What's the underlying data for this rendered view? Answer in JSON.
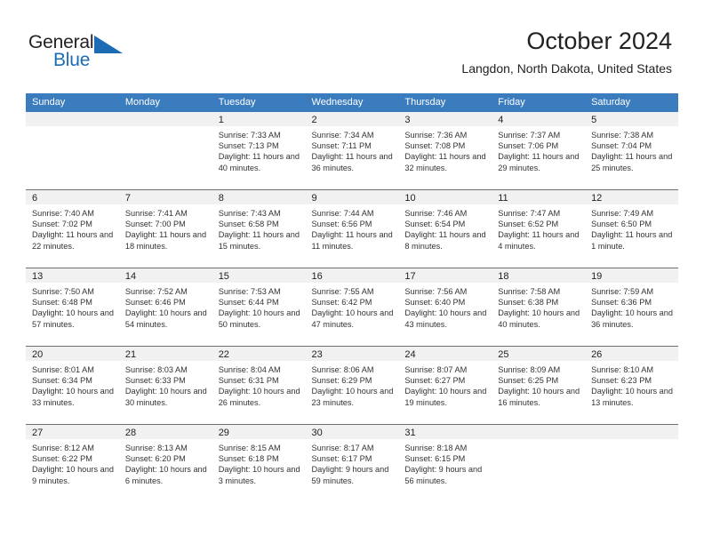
{
  "brand": {
    "name_part1": "General",
    "name_part2": "Blue",
    "triangle_icon": "triangle-icon",
    "accent_color": "#1b6cb5"
  },
  "header": {
    "title": "October 2024",
    "subtitle": "Langdon, North Dakota, United States"
  },
  "colors": {
    "header_row_bg": "#3a7cbe",
    "daynum_band_bg": "#f1f1f1",
    "grid_line": "#6f6f6f",
    "text": "#222222"
  },
  "weekday_headers": [
    "Sunday",
    "Monday",
    "Tuesday",
    "Wednesday",
    "Thursday",
    "Friday",
    "Saturday"
  ],
  "weeks": [
    [
      {
        "day": "",
        "sunrise": "",
        "sunset": "",
        "daylight": "",
        "empty": true
      },
      {
        "day": "",
        "sunrise": "",
        "sunset": "",
        "daylight": "",
        "empty": true
      },
      {
        "day": "1",
        "sunrise": "Sunrise: 7:33 AM",
        "sunset": "Sunset: 7:13 PM",
        "daylight": "Daylight: 11 hours and 40 minutes."
      },
      {
        "day": "2",
        "sunrise": "Sunrise: 7:34 AM",
        "sunset": "Sunset: 7:11 PM",
        "daylight": "Daylight: 11 hours and 36 minutes."
      },
      {
        "day": "3",
        "sunrise": "Sunrise: 7:36 AM",
        "sunset": "Sunset: 7:08 PM",
        "daylight": "Daylight: 11 hours and 32 minutes."
      },
      {
        "day": "4",
        "sunrise": "Sunrise: 7:37 AM",
        "sunset": "Sunset: 7:06 PM",
        "daylight": "Daylight: 11 hours and 29 minutes."
      },
      {
        "day": "5",
        "sunrise": "Sunrise: 7:38 AM",
        "sunset": "Sunset: 7:04 PM",
        "daylight": "Daylight: 11 hours and 25 minutes."
      }
    ],
    [
      {
        "day": "6",
        "sunrise": "Sunrise: 7:40 AM",
        "sunset": "Sunset: 7:02 PM",
        "daylight": "Daylight: 11 hours and 22 minutes."
      },
      {
        "day": "7",
        "sunrise": "Sunrise: 7:41 AM",
        "sunset": "Sunset: 7:00 PM",
        "daylight": "Daylight: 11 hours and 18 minutes."
      },
      {
        "day": "8",
        "sunrise": "Sunrise: 7:43 AM",
        "sunset": "Sunset: 6:58 PM",
        "daylight": "Daylight: 11 hours and 15 minutes."
      },
      {
        "day": "9",
        "sunrise": "Sunrise: 7:44 AM",
        "sunset": "Sunset: 6:56 PM",
        "daylight": "Daylight: 11 hours and 11 minutes."
      },
      {
        "day": "10",
        "sunrise": "Sunrise: 7:46 AM",
        "sunset": "Sunset: 6:54 PM",
        "daylight": "Daylight: 11 hours and 8 minutes."
      },
      {
        "day": "11",
        "sunrise": "Sunrise: 7:47 AM",
        "sunset": "Sunset: 6:52 PM",
        "daylight": "Daylight: 11 hours and 4 minutes."
      },
      {
        "day": "12",
        "sunrise": "Sunrise: 7:49 AM",
        "sunset": "Sunset: 6:50 PM",
        "daylight": "Daylight: 11 hours and 1 minute."
      }
    ],
    [
      {
        "day": "13",
        "sunrise": "Sunrise: 7:50 AM",
        "sunset": "Sunset: 6:48 PM",
        "daylight": "Daylight: 10 hours and 57 minutes."
      },
      {
        "day": "14",
        "sunrise": "Sunrise: 7:52 AM",
        "sunset": "Sunset: 6:46 PM",
        "daylight": "Daylight: 10 hours and 54 minutes."
      },
      {
        "day": "15",
        "sunrise": "Sunrise: 7:53 AM",
        "sunset": "Sunset: 6:44 PM",
        "daylight": "Daylight: 10 hours and 50 minutes."
      },
      {
        "day": "16",
        "sunrise": "Sunrise: 7:55 AM",
        "sunset": "Sunset: 6:42 PM",
        "daylight": "Daylight: 10 hours and 47 minutes."
      },
      {
        "day": "17",
        "sunrise": "Sunrise: 7:56 AM",
        "sunset": "Sunset: 6:40 PM",
        "daylight": "Daylight: 10 hours and 43 minutes."
      },
      {
        "day": "18",
        "sunrise": "Sunrise: 7:58 AM",
        "sunset": "Sunset: 6:38 PM",
        "daylight": "Daylight: 10 hours and 40 minutes."
      },
      {
        "day": "19",
        "sunrise": "Sunrise: 7:59 AM",
        "sunset": "Sunset: 6:36 PM",
        "daylight": "Daylight: 10 hours and 36 minutes."
      }
    ],
    [
      {
        "day": "20",
        "sunrise": "Sunrise: 8:01 AM",
        "sunset": "Sunset: 6:34 PM",
        "daylight": "Daylight: 10 hours and 33 minutes."
      },
      {
        "day": "21",
        "sunrise": "Sunrise: 8:03 AM",
        "sunset": "Sunset: 6:33 PM",
        "daylight": "Daylight: 10 hours and 30 minutes."
      },
      {
        "day": "22",
        "sunrise": "Sunrise: 8:04 AM",
        "sunset": "Sunset: 6:31 PM",
        "daylight": "Daylight: 10 hours and 26 minutes."
      },
      {
        "day": "23",
        "sunrise": "Sunrise: 8:06 AM",
        "sunset": "Sunset: 6:29 PM",
        "daylight": "Daylight: 10 hours and 23 minutes."
      },
      {
        "day": "24",
        "sunrise": "Sunrise: 8:07 AM",
        "sunset": "Sunset: 6:27 PM",
        "daylight": "Daylight: 10 hours and 19 minutes."
      },
      {
        "day": "25",
        "sunrise": "Sunrise: 8:09 AM",
        "sunset": "Sunset: 6:25 PM",
        "daylight": "Daylight: 10 hours and 16 minutes."
      },
      {
        "day": "26",
        "sunrise": "Sunrise: 8:10 AM",
        "sunset": "Sunset: 6:23 PM",
        "daylight": "Daylight: 10 hours and 13 minutes."
      }
    ],
    [
      {
        "day": "27",
        "sunrise": "Sunrise: 8:12 AM",
        "sunset": "Sunset: 6:22 PM",
        "daylight": "Daylight: 10 hours and 9 minutes."
      },
      {
        "day": "28",
        "sunrise": "Sunrise: 8:13 AM",
        "sunset": "Sunset: 6:20 PM",
        "daylight": "Daylight: 10 hours and 6 minutes."
      },
      {
        "day": "29",
        "sunrise": "Sunrise: 8:15 AM",
        "sunset": "Sunset: 6:18 PM",
        "daylight": "Daylight: 10 hours and 3 minutes."
      },
      {
        "day": "30",
        "sunrise": "Sunrise: 8:17 AM",
        "sunset": "Sunset: 6:17 PM",
        "daylight": "Daylight: 9 hours and 59 minutes."
      },
      {
        "day": "31",
        "sunrise": "Sunrise: 8:18 AM",
        "sunset": "Sunset: 6:15 PM",
        "daylight": "Daylight: 9 hours and 56 minutes."
      },
      {
        "day": "",
        "sunrise": "",
        "sunset": "",
        "daylight": "",
        "empty": true
      },
      {
        "day": "",
        "sunrise": "",
        "sunset": "",
        "daylight": "",
        "empty": true
      }
    ]
  ]
}
